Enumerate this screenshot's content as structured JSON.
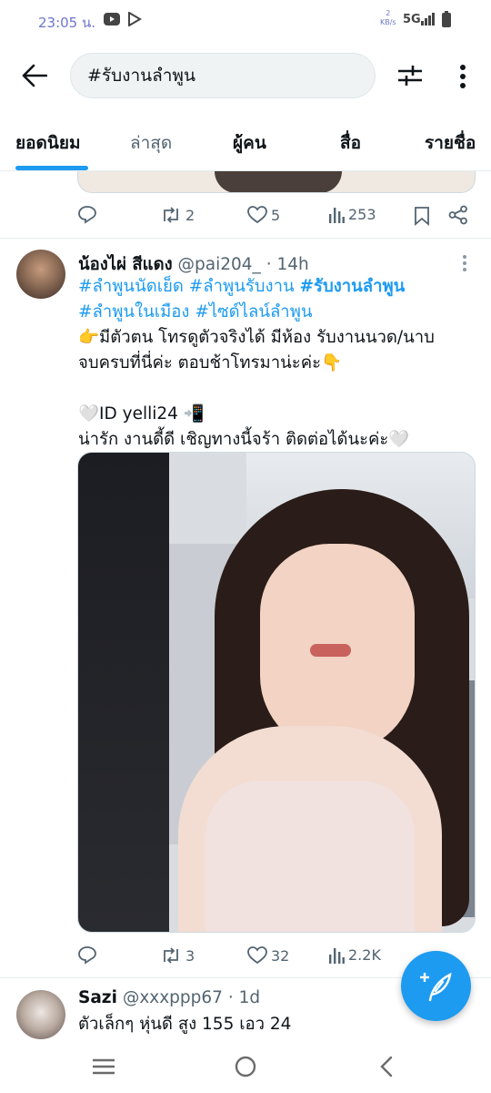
{
  "status": {
    "time": "23:05 น.",
    "net_speed": "2",
    "net_unit": "KB/s",
    "network": "5G"
  },
  "search": {
    "query": "#รับงานลำพูน"
  },
  "tabs": [
    {
      "label": "ยอดนิยม"
    },
    {
      "label": "ล่าสุด"
    },
    {
      "label": "ผู้คน"
    },
    {
      "label": "สื่อ"
    },
    {
      "label": "รายชื่อ"
    }
  ],
  "prev_tweet": {
    "retweets": "2",
    "likes": "5",
    "views": "253"
  },
  "tweet": {
    "name": "น้องไผ่ สีแดง",
    "handle": "@pai204_",
    "time": "· 14h",
    "tags_line1": [
      "#ลำพูนนัดเย็ด",
      "#ลำพูนรับงาน",
      "#รับงานลำพูน"
    ],
    "tags_line2": [
      "#ลำพูนในเมือง",
      "#ไซด์ไลน์ลำพูน"
    ],
    "body_line1": "👉มีตัวตน โทรดูตัวจริงได้ มีห้อง รับงานนวด/นาบ",
    "body_line2": "จบครบที่นี่ค่ะ ตอบช้าโทรมาน่ะค่ะ👇",
    "body_line3": "🤍ID yelli24 📲",
    "body_line4": "น่ารัก งานดี้ดี เชิญทางนี้จร้า ติดต่อได้นะค่ะ🤍",
    "retweets": "3",
    "likes": "32",
    "views": "2.2K"
  },
  "next_tweet": {
    "name": "Sazi",
    "handle": "@xxxppp67",
    "time": "· 1d",
    "body": "ตัวเล็กๆ หุ่นดี สูง 155 เอว 24"
  },
  "colors": {
    "accent": "#1d9bf0",
    "text": "#0f1419",
    "muted": "#536471"
  }
}
